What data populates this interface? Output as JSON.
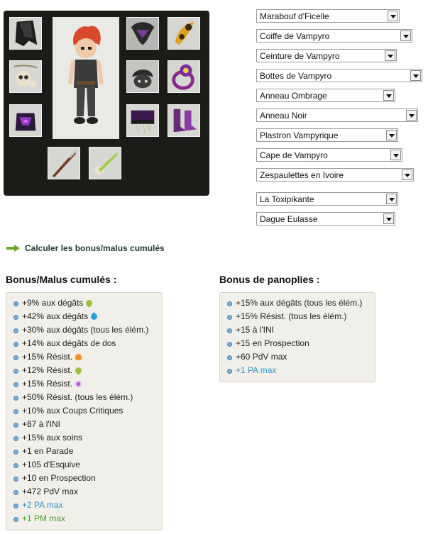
{
  "equipment_slots": [
    {
      "name": "cape-slot",
      "icon": "cape-icon"
    },
    {
      "name": "amulet-slot",
      "icon": "amulet-icon"
    },
    {
      "name": "shield-slot",
      "icon": "shield-icon"
    },
    {
      "name": "hat-slot",
      "icon": "hat-icon"
    },
    {
      "name": "dofus-slot-1",
      "icon": "horn-icon"
    },
    {
      "name": "ring-slot",
      "icon": "ring-icon"
    },
    {
      "name": "belt-slot",
      "icon": "belt-icon"
    },
    {
      "name": "boots-slot",
      "icon": "boots-icon"
    },
    {
      "name": "weapon-slot",
      "icon": "dagger-icon"
    },
    {
      "name": "pet-slot",
      "icon": "needle-icon"
    }
  ],
  "selects": [
    "Marabouf d'Ficelle",
    "Coiffe de Vampyro",
    "Ceinture de Vampyro",
    "Bottes de Vampyro",
    "Anneau Ombrage",
    "Anneau Noir",
    "Plastron Vampyrique",
    "Cape de Vampyro",
    "Zespaulettes en Ivoire",
    "La Toxipikante",
    "Dague Eulasse"
  ],
  "calc_link": "Calculer les bonus/malus cumulés",
  "cumul": {
    "title": "Bonus/Malus cumulés :",
    "items": [
      {
        "text": "+9% aux dégâts",
        "element": "earth",
        "color": "normal"
      },
      {
        "text": "+42% aux dégâts",
        "element": "water",
        "color": "normal"
      },
      {
        "text": "+30% aux dégâts (tous les élém.)",
        "element": "",
        "color": "normal"
      },
      {
        "text": "+14% aux dégâts de dos",
        "element": "",
        "color": "normal"
      },
      {
        "text": "+15% Résist.",
        "element": "fire",
        "color": "normal"
      },
      {
        "text": "+12% Résist.",
        "element": "earth",
        "color": "normal"
      },
      {
        "text": "+15% Résist.",
        "element": "air",
        "color": "normal"
      },
      {
        "text": "+50% Résist. (tous les élém.)",
        "element": "",
        "color": "normal"
      },
      {
        "text": "+10% aux Coups Critiques",
        "element": "",
        "color": "normal"
      },
      {
        "text": "+87 à l'INI",
        "element": "",
        "color": "normal"
      },
      {
        "text": "+15% aux soins",
        "element": "",
        "color": "normal"
      },
      {
        "text": "+1 en Parade",
        "element": "",
        "color": "normal"
      },
      {
        "text": "+105 d'Esquive",
        "element": "",
        "color": "normal"
      },
      {
        "text": "+10 en Prospection",
        "element": "",
        "color": "normal"
      },
      {
        "text": "+472 PdV max",
        "element": "",
        "color": "normal"
      },
      {
        "text": "+2 PA max",
        "element": "",
        "color": "pa"
      },
      {
        "text": "+1 PM max",
        "element": "",
        "color": "pm"
      }
    ]
  },
  "panoplies": {
    "title": "Bonus de panoplies :",
    "items": [
      {
        "text": "+15% aux dégâts (tous les élém.)",
        "color": "normal"
      },
      {
        "text": "+15% Résist. (tous les élém.)",
        "color": "normal"
      },
      {
        "text": "+15 à l'INI",
        "color": "normal"
      },
      {
        "text": "+15 en Prospection",
        "color": "normal"
      },
      {
        "text": "+60 PdV max",
        "color": "normal"
      },
      {
        "text": "+1 PA max",
        "color": "pa"
      }
    ]
  },
  "colors": {
    "pa": "#3a8fbf",
    "pm": "#4c9a2a",
    "panel": "#1b1b17",
    "box_bg": "#f1efea"
  }
}
